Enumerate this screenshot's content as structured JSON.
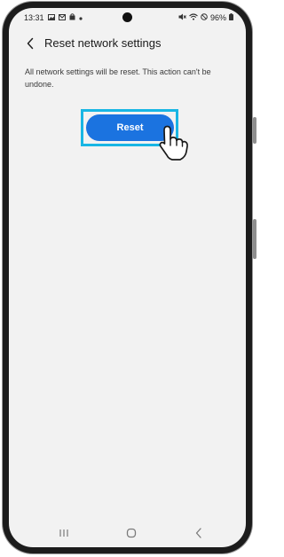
{
  "status_bar": {
    "time": "13:31",
    "battery": "96%",
    "left_icons": [
      "gallery-icon",
      "mail-icon",
      "shopping-bag-icon",
      "dot-icon"
    ],
    "right_icons": [
      "mute-icon",
      "wifi-icon",
      "no-signal-icon",
      "battery-icon"
    ]
  },
  "header": {
    "title": "Reset network settings",
    "back_icon": "chevron-left-icon"
  },
  "main": {
    "description": "All network settings will be reset. This action can't be undone.",
    "reset_label": "Reset",
    "highlight_color": "#19b6e4",
    "button_color": "#1b73e0"
  },
  "nav_bar": {
    "items": [
      "recents-icon",
      "home-icon",
      "back-icon"
    ]
  }
}
